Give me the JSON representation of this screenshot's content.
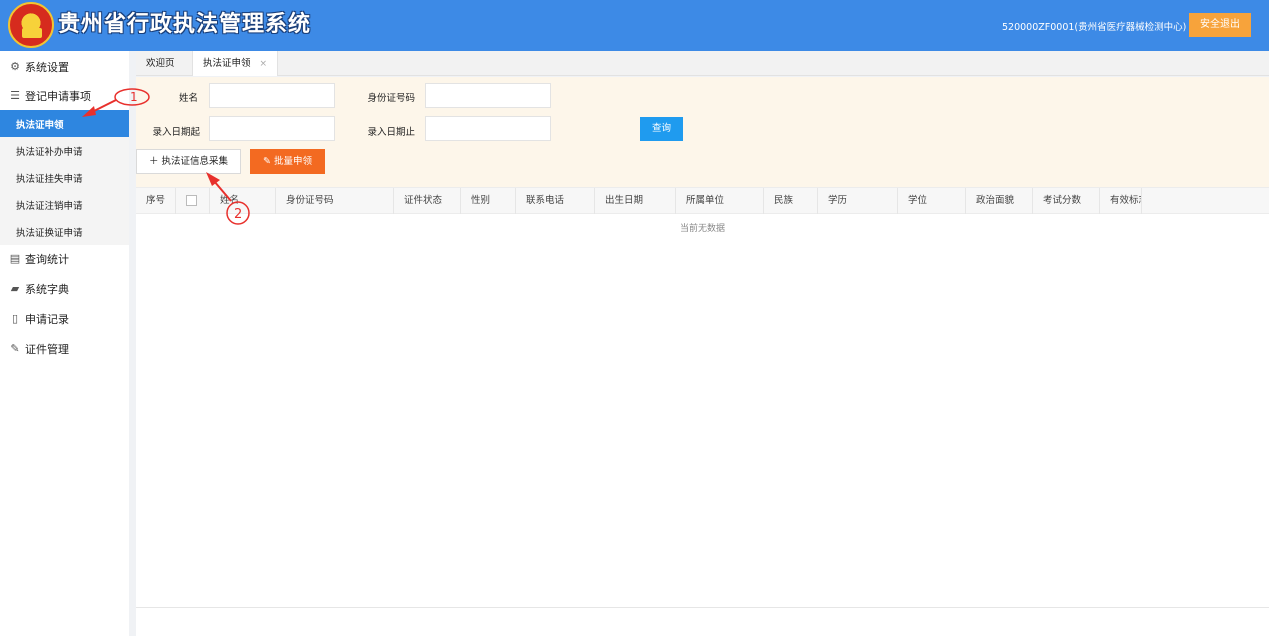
{
  "header": {
    "title": "贵州省行政执法管理系统",
    "user": "520000ZF0001(贵州省医疗器械检测中心)",
    "logout_label": "安全退出"
  },
  "sidebar": {
    "groups": [
      {
        "label": "系统设置",
        "icon": "gear-icon"
      },
      {
        "label": "登记申请事项",
        "icon": "sliders-icon"
      },
      {
        "label": "查询统计",
        "icon": "database-icon"
      },
      {
        "label": "系统字典",
        "icon": "book-icon"
      },
      {
        "label": "申请记录",
        "icon": "document-icon"
      },
      {
        "label": "证件管理",
        "icon": "wrench-icon"
      }
    ],
    "sub_items": [
      {
        "label": "执法证申领",
        "active": true
      },
      {
        "label": "执法证补办申请"
      },
      {
        "label": "执法证挂失申请"
      },
      {
        "label": "执法证注销申请"
      },
      {
        "label": "执法证换证申请"
      }
    ]
  },
  "tabs": [
    {
      "label": "欢迎页"
    },
    {
      "label": "执法证申领",
      "close": "×",
      "active": true
    }
  ],
  "search": {
    "name_label": "姓名",
    "id_label": "身份证号码",
    "date_start_label": "录入日期起",
    "date_end_label": "录入日期止",
    "query_label": "查询"
  },
  "actions": {
    "collect_label": "执法证信息采集",
    "batch_label": "批量申领"
  },
  "table": {
    "columns": [
      "序号",
      "",
      "姓名",
      "身份证号码",
      "证件状态",
      "性别",
      "联系电话",
      "出生日期",
      "所属单位",
      "民族",
      "学历",
      "学位",
      "政治面貌",
      "考试分数",
      "有效标志"
    ],
    "empty_text": "当前无数据"
  },
  "annotations": {
    "step1": "1",
    "step2": "2",
    "color": "#e8302c"
  }
}
